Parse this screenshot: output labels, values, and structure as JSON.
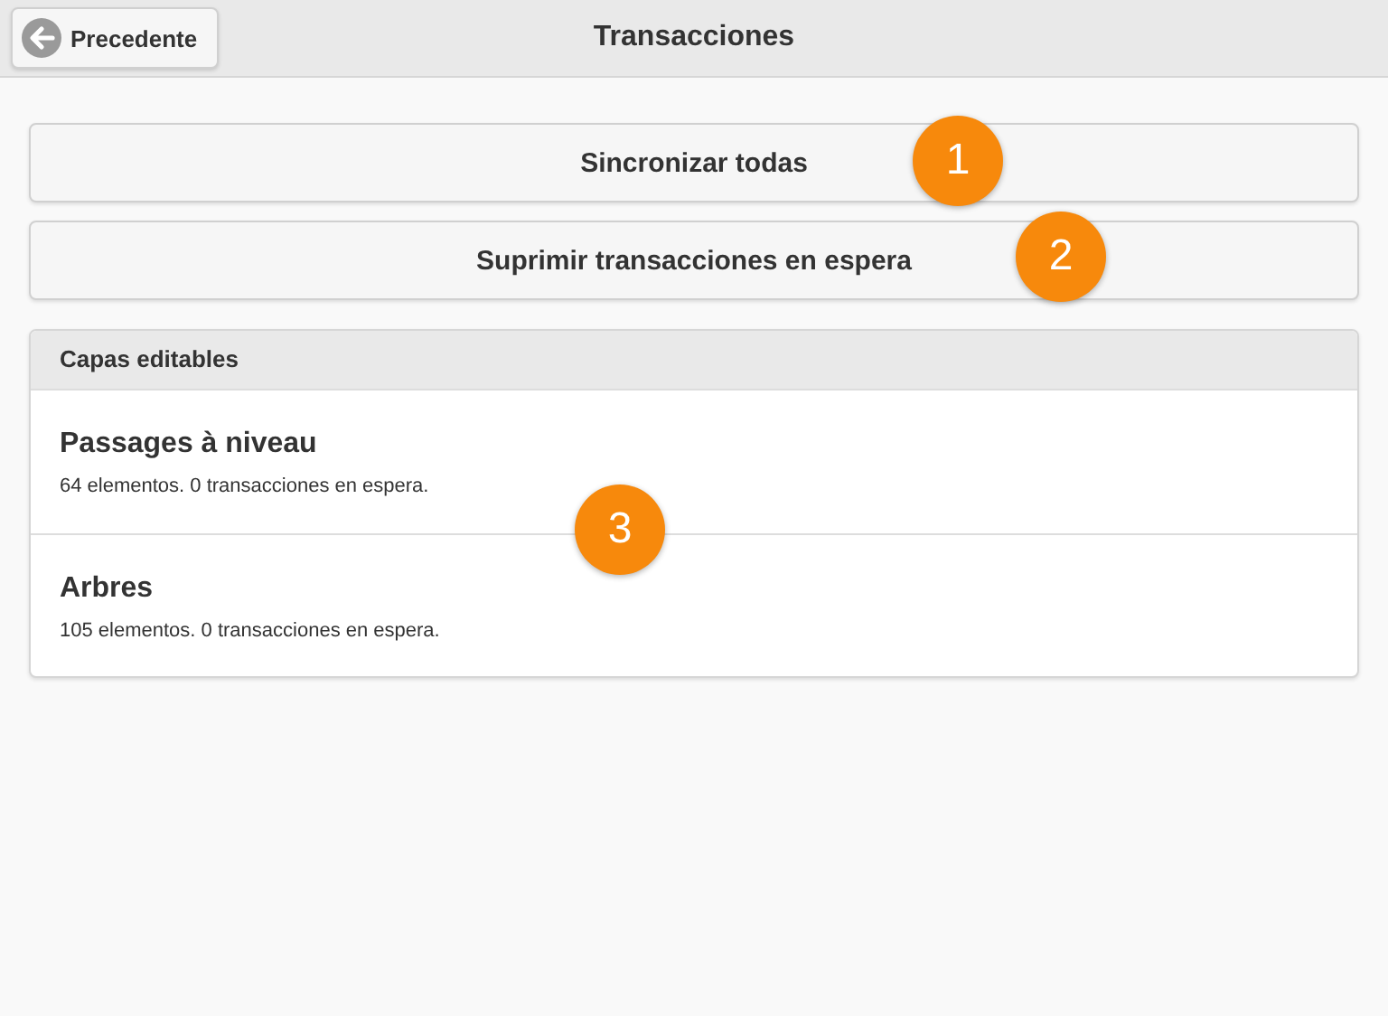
{
  "header": {
    "back_button": "Precedente",
    "title": "Transacciones"
  },
  "buttons": [
    "Sincronizar todas",
    "Suprimir transacciones en espera"
  ],
  "layers": {
    "heading": "Capas editables",
    "items": [
      {
        "name": "Passages à niveau",
        "detail": "64 elementos. 0 transacciones en espera."
      },
      {
        "name": "Arbres",
        "detail": "105 elementos. 0 transacciones en espera."
      }
    ]
  },
  "callouts": [
    {
      "label": "1"
    },
    {
      "label": "2"
    },
    {
      "label": "3"
    }
  ]
}
